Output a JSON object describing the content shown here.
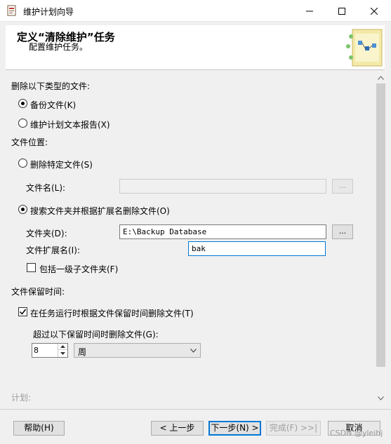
{
  "window": {
    "title": "维护计划向导",
    "icon": "wizard-app-icon"
  },
  "header": {
    "title": "定义“清除维护”任务",
    "subtitle": "配置维护任务。",
    "art_icon": "maintenance-plan-illustration"
  },
  "form": {
    "delete_files_type_label": "删除以下类型的文件:",
    "backup_files_label": "备份文件(K)",
    "backup_files_selected": true,
    "report_files_label": "维护计划文本报告(X)",
    "report_files_selected": false,
    "file_location_label": "文件位置:",
    "delete_specific_label": "删除特定文件(S)",
    "delete_specific_selected": false,
    "file_name_label": "文件名(L):",
    "file_name_value": "",
    "file_name_browse": "...",
    "search_folder_label": "搜索文件夹并根据扩展名删除文件(O)",
    "search_folder_selected": true,
    "folder_label": "文件夹(D):",
    "folder_value": "E:\\Backup Database",
    "folder_browse": "...",
    "extension_label": "文件扩展名(I):",
    "extension_value": "bak",
    "include_subfolders_label": "包括一级子文件夹(F)",
    "include_subfolders_checked": false,
    "retention_label": "文件保留时间:",
    "delete_by_age_label": "在任务运行时根据文件保留时间删除文件(T)",
    "delete_by_age_checked": true,
    "older_than_label": "超过以下保留时间时删除文件(G):",
    "age_value": "8",
    "age_unit": "周",
    "schedule_label": "计划:"
  },
  "footer": {
    "help": "帮助(H)",
    "back": "< 上一步",
    "next": "下一步(N) >",
    "finish": "完成(F) >>|",
    "cancel": "取消"
  },
  "watermark": "CSDN @yleihj"
}
